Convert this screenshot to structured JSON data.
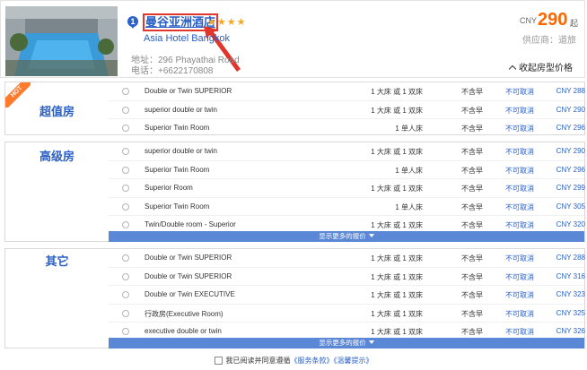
{
  "hotel": {
    "marker": "1",
    "name_cn": "曼谷亚洲酒店",
    "stars": "★★★★",
    "name_en": "Asia Hotel Bangkok",
    "address_label": "地址：",
    "address": "296 Phayathai Road",
    "phone_label": "电话：",
    "phone": "+6622170808",
    "price_currency": "CNY",
    "price": "290",
    "price_suffix": "起",
    "supplier_label": "供应商：",
    "supplier": "道旅",
    "collapse_label": "收起房型价格"
  },
  "groups": [
    {
      "title": "超值房",
      "hot_badge": "HOT",
      "rows": [
        {
          "name": "Double or Twin SUPERIOR",
          "bed": "1 大床 或 1 双床",
          "breakfast": "不含早",
          "cancel": "不可取消",
          "price": "CNY 288"
        },
        {
          "name": "superior double or twin",
          "bed": "1 大床 或 1 双床",
          "breakfast": "不含早",
          "cancel": "不可取消",
          "price": "CNY 290"
        },
        {
          "name": "Superior Twin Room",
          "bed": "1 单人床",
          "breakfast": "不含早",
          "cancel": "不可取消",
          "price": "CNY 296"
        }
      ]
    },
    {
      "title": "高级房",
      "more": "显示更多的报价",
      "rows": [
        {
          "name": "superior double or twin",
          "bed": "1 大床 或 1 双床",
          "breakfast": "不含早",
          "cancel": "不可取消",
          "price": "CNY 290"
        },
        {
          "name": "Superior Twin Room",
          "bed": "1 单人床",
          "breakfast": "不含早",
          "cancel": "不可取消",
          "price": "CNY 296"
        },
        {
          "name": "Superior Room",
          "bed": "1 大床 或 1 双床",
          "breakfast": "不含早",
          "cancel": "不可取消",
          "price": "CNY 299"
        },
        {
          "name": "Superior Twin Room",
          "bed": "1 单人床",
          "breakfast": "不含早",
          "cancel": "不可取消",
          "price": "CNY 305"
        },
        {
          "name": "Twin/Double room - Superior",
          "bed": "1 大床 或 1 双床",
          "breakfast": "不含早",
          "cancel": "不可取消",
          "price": "CNY 320"
        }
      ]
    },
    {
      "title": "其它",
      "more": "显示更多的报价",
      "rows": [
        {
          "name": "Double or Twin SUPERIOR",
          "bed": "1 大床 或 1 双床",
          "breakfast": "不含早",
          "cancel": "不可取消",
          "price": "CNY 288"
        },
        {
          "name": "Double or Twin SUPERIOR",
          "bed": "1 大床 或 1 双床",
          "breakfast": "不含早",
          "cancel": "不可取消",
          "price": "CNY 316"
        },
        {
          "name": "Double or Twin EXECUTIVE",
          "bed": "1 大床 或 1 双床",
          "breakfast": "不含早",
          "cancel": "不可取消",
          "price": "CNY 323"
        },
        {
          "name": "行政房(Executive Room)",
          "bed": "1 大床 或 1 双床",
          "breakfast": "不含早",
          "cancel": "不可取消",
          "price": "CNY 325"
        },
        {
          "name": "executive double or twin",
          "bed": "1 大床 或 1 双床",
          "breakfast": "不含早",
          "cancel": "不可取消",
          "price": "CNY 326"
        }
      ]
    }
  ],
  "agreement": {
    "text": "我已阅读并同意遵循",
    "link1": "《服务条款》",
    "link2": "《温馨提示》"
  },
  "colors": {
    "accent": "#2a5fc4",
    "price": "#ff6600",
    "more_bar": "#5b88d6",
    "hot": "#ff7a2a",
    "highlight": "#e2352c"
  }
}
